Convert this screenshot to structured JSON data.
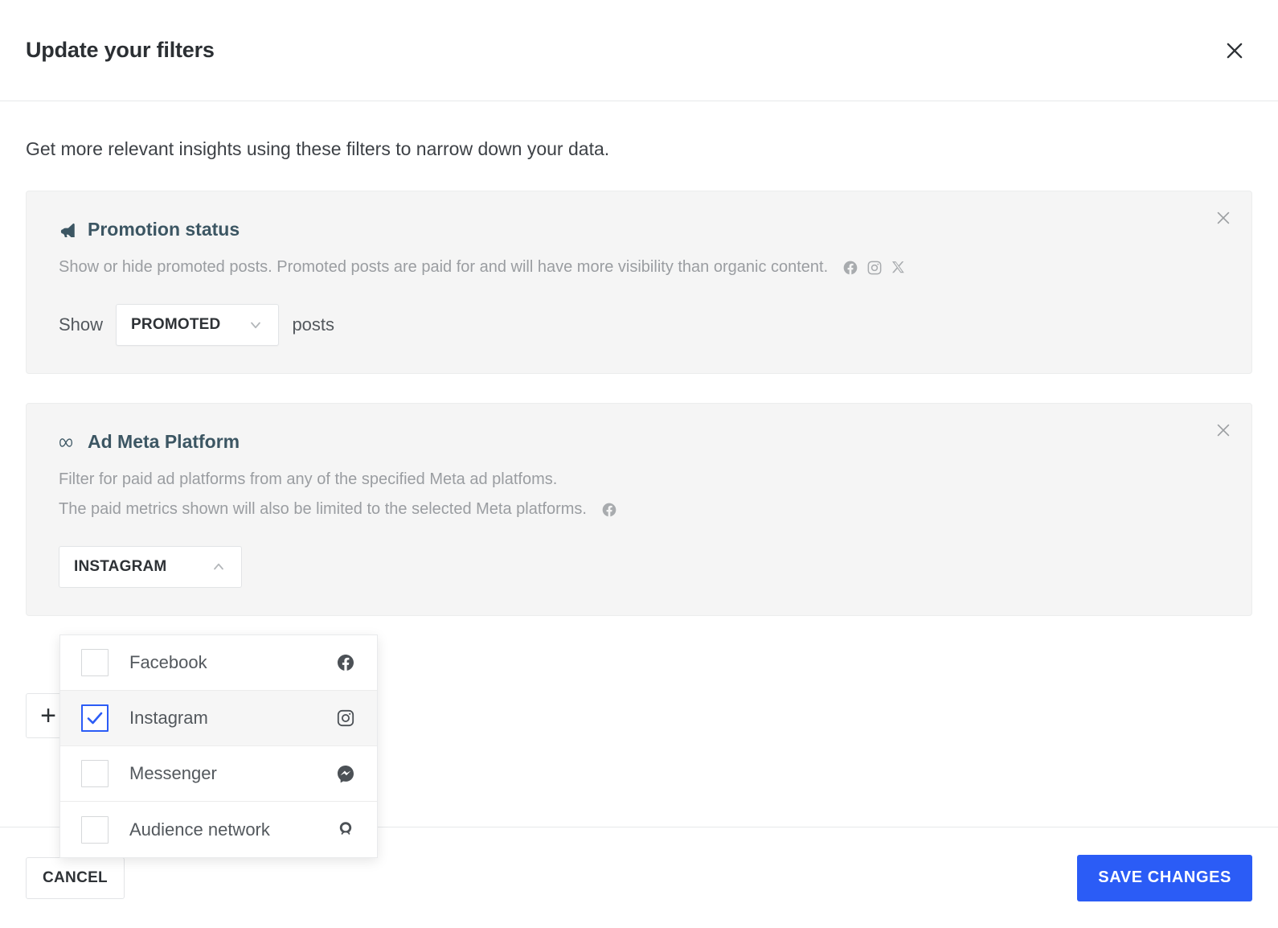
{
  "header": {
    "title": "Update your filters",
    "close_icon": "close-icon"
  },
  "body": {
    "intro": "Get more relevant insights using these filters to narrow down your data."
  },
  "filters": [
    {
      "id": "promotion-status",
      "icon": "megaphone-icon",
      "title": "Promotion status",
      "description": "Show or hide promoted posts. Promoted posts are paid for and will have more visibility than organic content.",
      "desc_icons": [
        "facebook-icon",
        "instagram-icon",
        "x-twitter-icon"
      ],
      "control": {
        "prefix_label": "Show",
        "suffix_label": "posts",
        "selected": "PROMOTED",
        "caret": "chevron-down-icon"
      }
    },
    {
      "id": "ad-meta-platform",
      "icon": "meta-infinity-icon",
      "title": "Ad Meta Platform",
      "description_line1": "Filter for paid ad platforms from any of the specified Meta ad platfoms.",
      "description_line2": "The paid metrics shown will also be limited to the selected Meta platforms.",
      "desc_icons_line2": [
        "facebook-icon"
      ],
      "control": {
        "selected": "INSTAGRAM",
        "caret": "chevron-up-icon"
      }
    }
  ],
  "dropdown": {
    "open": true,
    "options": [
      {
        "label": "Facebook",
        "checked": false,
        "icon": "facebook-icon"
      },
      {
        "label": "Instagram",
        "checked": true,
        "icon": "instagram-icon"
      },
      {
        "label": "Messenger",
        "checked": false,
        "icon": "messenger-icon"
      },
      {
        "label": "Audience network",
        "checked": false,
        "icon": "audience-network-icon"
      }
    ]
  },
  "add_filter": {
    "label": "+"
  },
  "footer": {
    "cancel_label": "CANCEL",
    "save_label": "SAVE CHANGES"
  },
  "colors": {
    "accent": "#2b5cf6",
    "heading": "#3c5663",
    "card_bg": "#f5f5f5",
    "muted_text": "#9a9da1"
  }
}
